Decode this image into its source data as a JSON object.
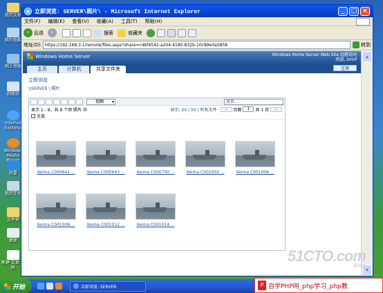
{
  "desktop": {
    "icons": [
      "我的文档",
      "我的电脑",
      "网上邻居",
      "回收站",
      "Internet Explorer",
      "Windows Media Player",
      "迅雷",
      "我的车托",
      "文件夹",
      "桌面",
      "新建 文本 文档"
    ]
  },
  "window": {
    "title": "立即浏览: SERVER\\照片\\ - Microsoft Internet Explorer",
    "menu": [
      "文件(F)",
      "编辑(E)",
      "查看(V)",
      "收藏(A)",
      "工具(T)",
      "帮助(H)"
    ],
    "toolbar": {
      "back": "后退",
      "search": "搜索",
      "favorites": "收藏夹"
    },
    "address_label": "地址(D)",
    "address_value": "https://192.168.3.1/remote/files.aspx?share=c4bf4542-a204-4180-832b-10c89e0a5858",
    "go_label": "转到"
  },
  "whs": {
    "brand": "Windows Home Server",
    "site_name": "Windows Home Server Web Site 远程访问",
    "welcome": "欢迎, zmnf",
    "tabs": [
      "主页",
      "计算机",
      "共享文件夹"
    ],
    "active_tab": 2,
    "logout": "注销",
    "page_title": "立即浏览",
    "breadcrumb": "\\\\SERVER \\ 照片",
    "view_label": "视图",
    "search_placeholder": "搜索...",
    "showing": "显示 1 - 8，共 8 个项 照片 中",
    "show_links": "显示: 20 | 50 | 所有文件",
    "page_label": "页面",
    "page_value": "1",
    "page_of": "共 1 页",
    "select_all": "全选",
    "files": [
      "Xeima C000641 ...",
      "Xeima C000643 ...",
      "Xeima C000700 ...",
      "Xeima C001002 ...",
      "Xeima C001006 ...",
      "Xeima C001008 ...",
      "Xeima C001012 ...",
      "Xeima C001014 ..."
    ]
  },
  "taskbar": {
    "start": "开始",
    "task": "立即浏览: SERVER"
  },
  "watermark": {
    "main": "51CTO.com",
    "sub": "Blog"
  },
  "ad": {
    "text": "自学PHP网_php学习_php教"
  }
}
